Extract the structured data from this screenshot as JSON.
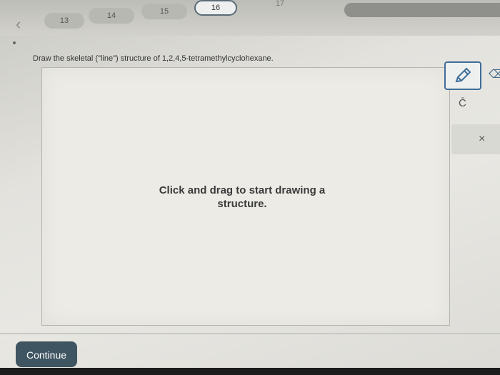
{
  "nav": {
    "back_glyph": "‹",
    "questions": [
      {
        "num": "13"
      },
      {
        "num": "14"
      },
      {
        "num": "15"
      },
      {
        "num": "16",
        "current": true
      },
      {
        "num": "17"
      }
    ]
  },
  "question": {
    "prompt": "Draw the skeletal (\"line\") structure of 1,2,4,5-tetramethylcyclohexane."
  },
  "canvas": {
    "hint": "Click and drag to start drawing a structure."
  },
  "tools": {
    "pencil_icon": "pencil-icon",
    "charge_label": "C̄",
    "delete_label": "×"
  },
  "footer": {
    "continue_label": "Continue"
  },
  "colors": {
    "accent": "#3d6e99",
    "continue_bg": "#3f5561"
  }
}
